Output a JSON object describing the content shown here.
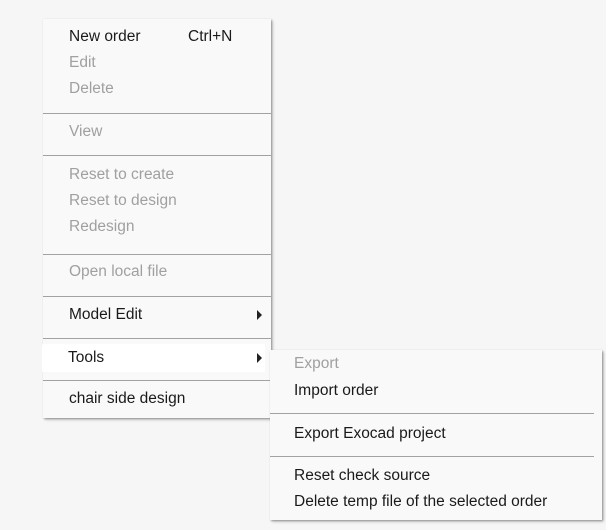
{
  "main_menu": {
    "new_order": "New order",
    "new_order_shortcut": "Ctrl+N",
    "edit": "Edit",
    "delete": "Delete",
    "view": "View",
    "reset_to_create": "Reset to create",
    "reset_to_design": "Reset to design",
    "redesign": "Redesign",
    "open_local_file": "Open local file",
    "model_edit": "Model Edit",
    "tools": "Tools",
    "chair_side_design": "chair side design"
  },
  "tools_submenu": {
    "export": "Export",
    "import_order": "Import order",
    "export_exocad_project": "Export Exocad project",
    "reset_check_source": "Reset check source",
    "delete_temp_file": "Delete temp file of the selected order"
  },
  "icons": {
    "submenu_arrow": "submenu-arrow-icon"
  },
  "colors": {
    "background": "#f6f6f6",
    "menu_background": "#f9f9f9",
    "highlight": "#ffffff",
    "enabled_text": "#1a1a1a",
    "disabled_text": "#a0a0a0",
    "separator": "#a2a2a2"
  }
}
